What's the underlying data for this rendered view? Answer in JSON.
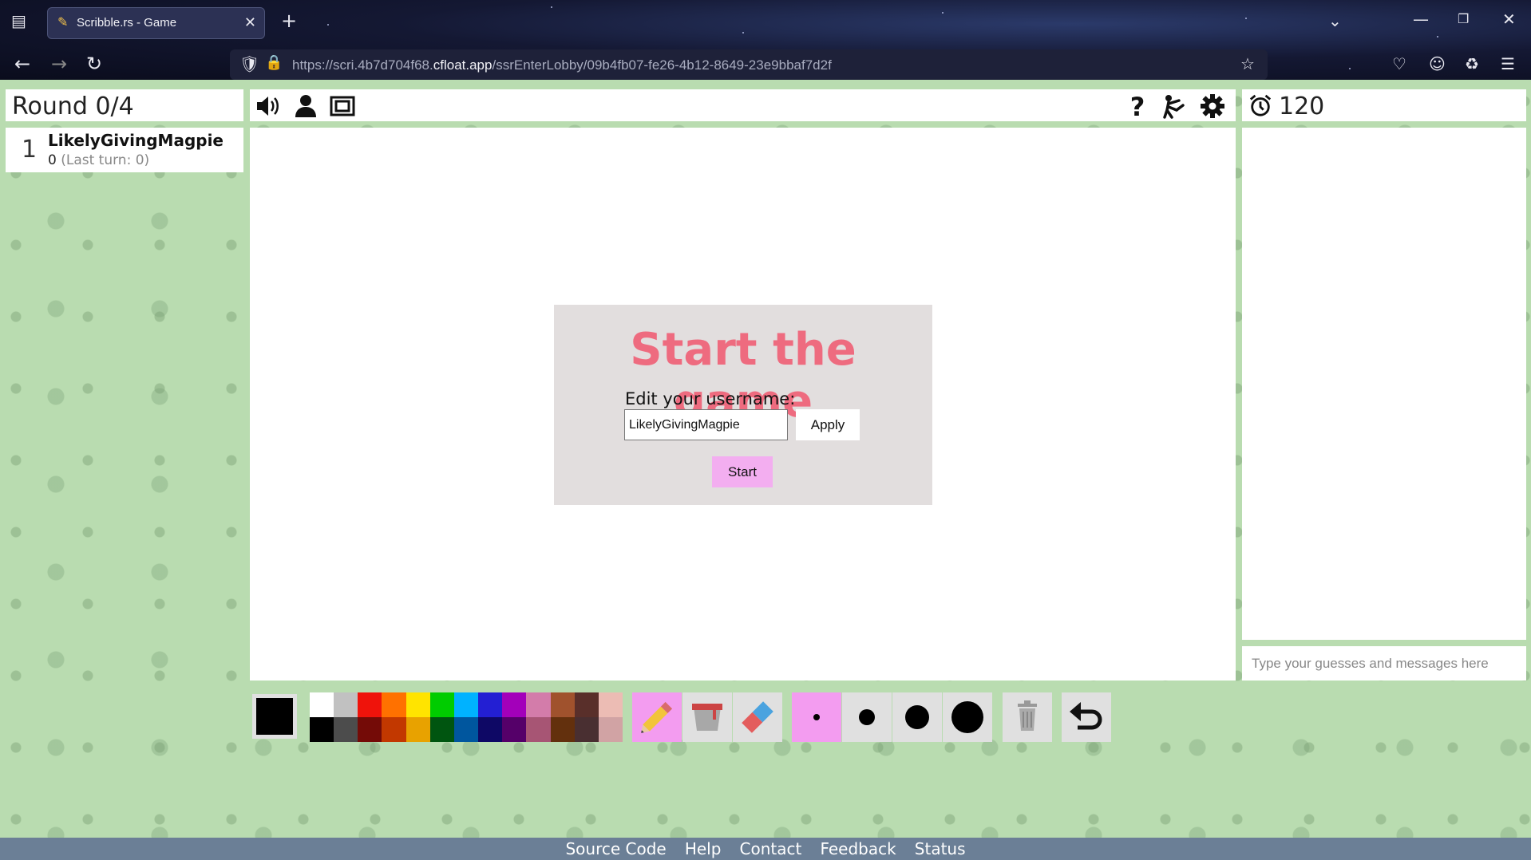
{
  "browser": {
    "tab_title": "Scribble.rs - Game",
    "url_prefix": "https://scri.4b7d704f68.",
    "url_host": "cfloat.app",
    "url_path": "/ssrEnterLobby/09b4fb07-fe26-4b12-8649-23e9bbaf7d2f"
  },
  "game": {
    "round": "Round 0/4",
    "timer": "120",
    "players": [
      {
        "rank": "1",
        "name": "LikelyGivingMagpie",
        "score": "0",
        "last_turn": "(Last turn: 0)"
      }
    ]
  },
  "dialog": {
    "title": "Start the game",
    "edit_label": "Edit your username:",
    "username_value": "LikelyGivingMagpie",
    "apply_label": "Apply",
    "start_label": "Start"
  },
  "chat": {
    "placeholder": "Type your guesses and messages here"
  },
  "tools": {
    "current_color": "#000000",
    "palette_top": [
      "#ffffff",
      "#c1c1c1",
      "#ef130b",
      "#ff7100",
      "#ffe400",
      "#00cc00",
      "#00b2ff",
      "#231fd3",
      "#a300ba",
      "#d37caa",
      "#a0522d",
      "#592f2a",
      "#ecbcb4"
    ],
    "palette_bottom": [
      "#000000",
      "#4c4c4c",
      "#740b07",
      "#c23800",
      "#e8a200",
      "#005510",
      "#00569e",
      "#0e0865",
      "#550069",
      "#a75574",
      "#63300d",
      "#492f31",
      "#d1a3a4"
    ],
    "active_tool": "pencil",
    "active_size": "small"
  },
  "footer": {
    "links": [
      "Source Code",
      "Help",
      "Contact",
      "Feedback",
      "Status"
    ]
  }
}
